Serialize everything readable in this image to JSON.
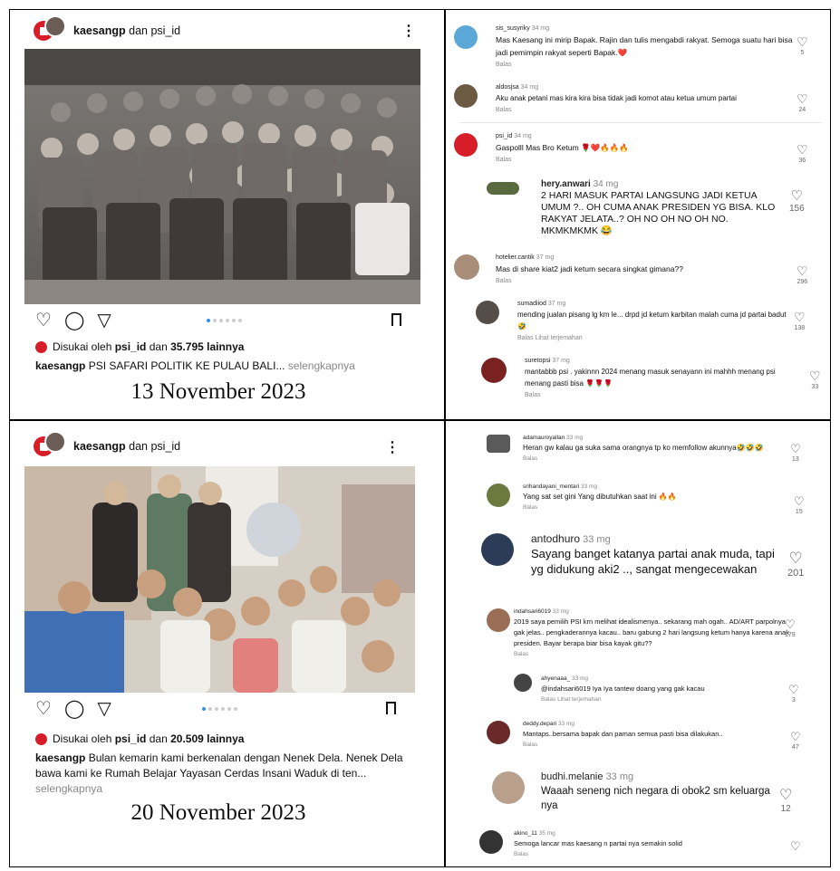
{
  "posts": [
    {
      "user_line_a": "kaesangp",
      "user_line_b": " dan psi_id",
      "liked_prefix": "Disukai oleh ",
      "liked_user": "psi_id",
      "liked_mid": " dan ",
      "liked_count": "35.795 lainnya",
      "caption_user": "kaesangp",
      "caption_text": " PSI SAFARI POLITIK KE PULAU BALI...",
      "caption_more": " selengkapnya",
      "date": "13 November 2023"
    },
    {
      "user_line_a": "kaesangp",
      "user_line_b": " dan psi_id",
      "liked_prefix": "Disukai oleh ",
      "liked_user": "psi_id",
      "liked_mid": " dan ",
      "liked_count": "20.509 lainnya",
      "caption_user": "kaesangp",
      "caption_text": " Bulan kemarin kami berkenalan dengan Nenek Dela. Nenek Dela bawa kami ke Rumah Belajar Yayasan Cerdas Insani Waduk di ten...",
      "caption_more": "selengkapnya",
      "date": "20 November 2023"
    }
  ],
  "icons": {
    "like": "heart-icon",
    "comment": "comment-icon",
    "share": "send-icon",
    "save": "bookmark-icon",
    "more": "kebab-icon"
  },
  "colors": {
    "psi_red": "#d71e28",
    "carousel_active": "#2f8df5"
  },
  "comments_top": [
    {
      "user": "sis_susyriky",
      "time": "34 mg",
      "text": "Mas Kaesang ini mirip Bapak. Rajin dan tulis mengabdi rakyat. Semoga suatu hari bisa jadi pemimpin rakyat seperti Bapak.❤️",
      "reply": "Balas",
      "likes": "5"
    },
    {
      "user": "aldosjsa",
      "time": "34 mg",
      "text": "Aku anak petani mas kira kira bisa tidak jadi komot atau ketua umum partai",
      "reply": "Balas",
      "likes": "24"
    },
    {
      "user": "psi_id",
      "time": "34 mg",
      "text": "Gaspolll Mas Bro Ketum 🌹❤️🔥🔥🔥",
      "reply": "Balas",
      "likes": "36"
    },
    {
      "user": "hery.anwari",
      "time": "34 mg",
      "text": "2 HARI MASUK PARTAI LANGSUNG JADI KETUA UMUM ?.. OH CUMA ANAK PRESIDEN YG BISA. KLO RAKYAT JELATA..? OH NO OH NO OH NO. MKMKMKMK 😂",
      "reply": "",
      "likes": "156"
    },
    {
      "user": "hotelier.cantik",
      "time": "37 mg",
      "text": "Mas di share kiat2 jadi ketum secara singkat gimana??",
      "reply": "Balas",
      "likes": "296"
    },
    {
      "user": "sumadiiod",
      "time": "37 mg",
      "text": "mending jualan pisang lg km le... drpd jd ketum karbitan malah cuma jd partai badut🤣",
      "reply": "Balas   Lihat terjemahan",
      "likes": "138"
    },
    {
      "user": "suretopsi",
      "time": "37 mg",
      "text": "mantabbb psi . yakinnn 2024 menang masuk senayann ini mahhh menang psi menang pasti bisa 🌹🌹🌹",
      "reply": "Balas",
      "likes": "33"
    }
  ],
  "comments_bottom": [
    {
      "user": "adamauroyallan",
      "time": "33 mg",
      "text": "Heran gw kalau ga suka sama orangnya tp ko memfollow akunnya🤣🤣🤣",
      "reply": "Balas",
      "likes": "13"
    },
    {
      "user": "srihandayani_mentari",
      "time": "33 mg",
      "text": "Yang sat set gini Yang dibutuhkan saat ini 🔥🔥",
      "reply": "Balas",
      "likes": "15"
    },
    {
      "user": "antodhuro",
      "time": "33 mg",
      "text": "Sayang banget katanya partai anak muda, tapi yg didukung aki2 .., sangat mengecewakan",
      "reply": "",
      "likes": "201"
    },
    {
      "user": "indahsari6019",
      "time": "33 mg",
      "text": "2019 saya pemilih PSI krn melihat idealismenya.. sekarang mah ogah.. AD/ART parpolnya gak jelas.. pengkaderannya kacau.. baru gabung 2 hari langsung ketum hanya karena anak presiden. Bayar berapa biar bisa kayak gitu??",
      "reply": "Balas",
      "likes": "179"
    },
    {
      "user": "ahyenaaa_",
      "time": "33 mg",
      "text": "@indahsari6019 Iya Iya tantew doang yang gak kacau",
      "reply": "Balas   Lihat terjemahan",
      "likes": "3"
    },
    {
      "user": "deddy.depari",
      "time": "33 mg",
      "text": "Mantaps..bersama bapak dan paman semua pasti bisa dilakukan..",
      "reply": "Balas",
      "likes": "47"
    },
    {
      "user": "budhi.melanie",
      "time": "33 mg",
      "text": "Waaah seneng nich negara di obok2 sm keluarga nya",
      "reply": "",
      "likes": "12"
    },
    {
      "user": "akino_11",
      "time": "35 mg",
      "text": "Semoga lancar mas kaesang n partai nya semakin solid",
      "reply": "Balas",
      "likes": ""
    }
  ]
}
